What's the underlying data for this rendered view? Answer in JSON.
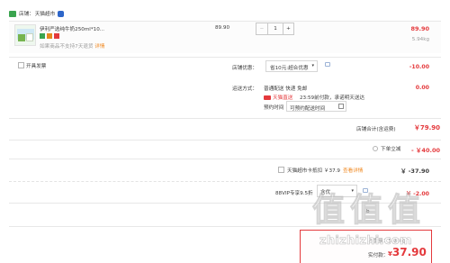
{
  "store": {
    "label": "店铺：",
    "name": "天猫超市"
  },
  "item": {
    "title": "伊利严选纯牛奶250ml*10...",
    "note_prefix": "如果商品",
    "note_suffix": "不支持7天退货",
    "note_link": "详情",
    "unit_price": "89.90",
    "quantity": "1",
    "minus": "−",
    "plus": "+",
    "subtotal": "89.90",
    "weight": "5.94kg"
  },
  "invoice": {
    "label": "开具发票"
  },
  "store_promo": {
    "label": "店铺优惠：",
    "select_value": "省10元:超合优惠",
    "amount": "-10.00"
  },
  "shipping": {
    "label": "运送方式：",
    "method": "普通配送 快递 免邮",
    "badge": "天猫直送",
    "promise": "23:59前付款，承诺明天送达",
    "time_label": "预约时间",
    "time_placeholder": "可预约配送时间",
    "amount": "0.00"
  },
  "store_total": {
    "label": "店铺合计(含运费)",
    "amount": "￥79.90"
  },
  "instant_discount": {
    "label": "下单立减",
    "amount": "- ￥40.00"
  },
  "card_discount": {
    "label": "天猫超市卡抵扣 ￥37.9",
    "link": "查看详情",
    "amount": "￥ -37.90"
  },
  "vip_discount": {
    "label": "88VIP专享9.5折",
    "select_value": "含优",
    "amount": "￥ -2.00"
  },
  "summary": {
    "letter": "b",
    "weight": "总重量：5.94kg",
    "paid_label": "实付款：",
    "paid_amount": "37.90"
  },
  "watermark": {
    "logo_chars": [
      "值",
      "值",
      "值"
    ],
    "site": "zhizhizhi.com"
  },
  "colors": {
    "accent": "#e4393c",
    "store_icon": "#3aa44f",
    "tmall_blue": "#2e66c9"
  }
}
